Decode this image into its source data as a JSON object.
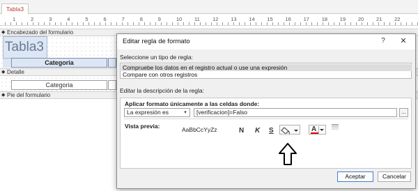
{
  "document": {
    "tab_label": "Tabla3",
    "ruler_numbers": [
      "1",
      "2",
      "3",
      "4",
      "5",
      "6",
      "7",
      "8",
      "9",
      "10",
      "11",
      "12",
      "13",
      "14",
      "15",
      "16",
      "17",
      "18",
      "19",
      "20",
      "21",
      "22"
    ],
    "sections": {
      "header": "Encabezado del formulario",
      "detail": "Detalle",
      "footer": "Pie del formulario"
    },
    "form_title": "Tabla3",
    "header_label": "Categoria",
    "detail_field": "Categoria"
  },
  "dialog": {
    "title": "Editar regla de formato",
    "help": "?",
    "close": "✕",
    "rule_type_label": "Seleccione un tipo de regla:",
    "rule_types": [
      "Compruebe los datos en el registro actual o use una expresión",
      "Compare con otros registros"
    ],
    "selected_rule_type": 0,
    "description_label": "Editar la descripción de la regla:",
    "apply_label": "Aplicar formato únicamente a las celdas donde:",
    "condition_combo": "La expresión es",
    "expression_value": "[verificacion]=Falso",
    "builder_button": "...",
    "preview_label": "Vista previa:",
    "preview_sample": "AaBbCcYyZz",
    "bold_label": "N",
    "italic_label": "K",
    "underline_label": "S",
    "font_color_glyph": "A",
    "accept_label": "Aceptar",
    "cancel_label": "Cancelar",
    "colors": {
      "font_color_bar": "#e00000"
    }
  }
}
